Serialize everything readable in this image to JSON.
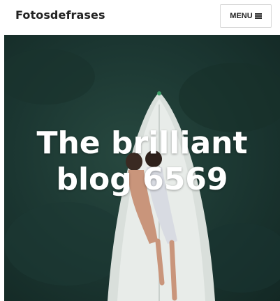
{
  "header": {
    "brand": "Fotosdefrases",
    "menu_label": "MENU"
  },
  "hero": {
    "title_line1": "The brilliant",
    "title_line2": "blog 6569"
  },
  "icons": {
    "menu": "hamburger-icon"
  },
  "colors": {
    "header_background": "#ffffff",
    "brand_text": "#222222",
    "hero_water": "#1b3631",
    "hero_title": "#ffffff"
  }
}
